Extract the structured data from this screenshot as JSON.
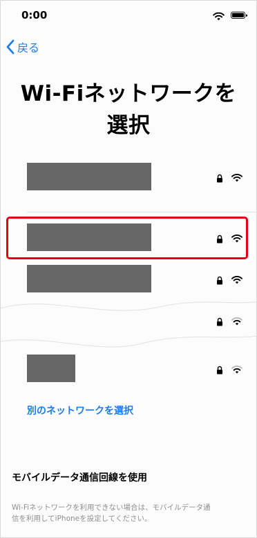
{
  "status_bar": {
    "time": "0:00",
    "wifi_icon": "wifi-icon",
    "battery_icon": "battery-icon"
  },
  "nav": {
    "back_label": "戻る",
    "back_icon": "chevron-left-icon"
  },
  "title": {
    "line1": "Wi-Fiネットワークを",
    "line2": "選択"
  },
  "networks": [
    {
      "redacted": true,
      "locked": true,
      "signal": "full",
      "selected": false
    },
    {
      "redacted": true,
      "locked": true,
      "signal": "full",
      "selected": true
    },
    {
      "redacted": true,
      "locked": true,
      "signal": "full",
      "selected": false
    },
    {
      "redacted": true,
      "locked": true,
      "signal": "weak",
      "selected": false
    },
    {
      "redacted": true,
      "locked": true,
      "signal": "weak",
      "selected": false
    }
  ],
  "other_network_label": "別のネットワークを選択",
  "cellular": {
    "heading": "モバイルデータ通信回線を使用",
    "note_line1": "Wi-Fiネットワークを利用できない場合は、モバイルデータ通",
    "note_line2": "信を利用してiPhoneを設定してください。"
  },
  "colors": {
    "accent": "#1a7cf2",
    "highlight": "#e00012",
    "redaction": "#666666",
    "note_text": "#8e8e93"
  }
}
